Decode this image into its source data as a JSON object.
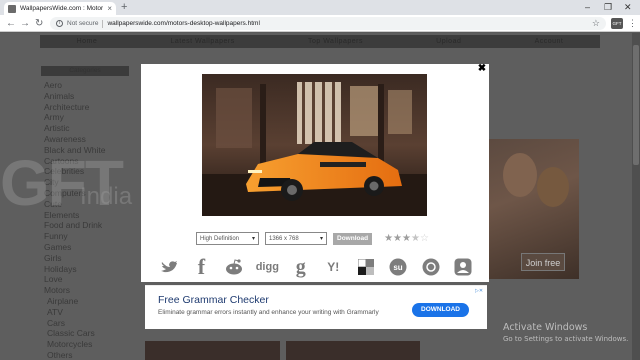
{
  "browser": {
    "tab_title": "WallpapersWide.com : Motors W",
    "tab_close": "×",
    "new_tab": "+",
    "window_controls": [
      "–",
      "❐",
      "✕"
    ],
    "nav": {
      "back": "←",
      "forward": "→",
      "reload": "↻"
    },
    "security_label": "Not secure",
    "url": "wallpaperswide.com/motors-desktop-wallpapers.html",
    "profile_label": "GFT",
    "menu_icon": "⋮"
  },
  "page": {
    "topnav": [
      "Home",
      "Latest Wallpapers",
      "Top Wallpapers",
      "Upload",
      "Account"
    ],
    "sidebar_heading": "Categories",
    "categories": [
      "Aero",
      "Animals",
      "Architecture",
      "Army",
      "Artistic",
      "Awareness",
      "Black and White",
      "Cartoons",
      "Celebrities",
      "City",
      "Computers",
      "Cute",
      "Elements",
      "Food and Drink",
      "Funny",
      "Games",
      "Girls",
      "Holidays",
      "Love",
      "Motors"
    ],
    "subcategories": [
      "Airplane",
      "ATV",
      "Cars",
      "Classic Cars",
      "Motorcycles",
      "Others"
    ],
    "watermark": "GFT",
    "watermark_sub": "India",
    "side_ad_button": "Join free",
    "activate_title": "Activate Windows",
    "activate_text": "Go to Settings to activate Windows."
  },
  "modal": {
    "close": "✖",
    "quality_select": "High Definition",
    "resolution_select": "1366 x 768",
    "download_label": "Download",
    "rating": 3.5,
    "stars_filled": "★★★",
    "stars_half": "★",
    "stars_empty": "☆",
    "socials": [
      {
        "name": "twitter-icon",
        "glyph": "t"
      },
      {
        "name": "facebook-icon",
        "glyph": "f"
      },
      {
        "name": "reddit-icon",
        "glyph": "👽"
      },
      {
        "name": "digg-icon",
        "glyph": "digg"
      },
      {
        "name": "google-icon",
        "glyph": "g"
      },
      {
        "name": "yahoo-icon",
        "glyph": "Y!"
      },
      {
        "name": "delicious-icon",
        "glyph": "▦"
      },
      {
        "name": "stumbleupon-icon",
        "glyph": "su"
      },
      {
        "name": "refresh-icon",
        "glyph": "⟳"
      },
      {
        "name": "myspace-icon",
        "glyph": "👥"
      }
    ],
    "ad": {
      "title": "Free Grammar Checker",
      "text": "Eliminate grammar errors instantly and enhance your writing with Grammarly",
      "button": "DOWNLOAD",
      "mark": "▷✕"
    }
  },
  "colors": {
    "accent_orange": "#f08a1c",
    "ad_blue": "#1a73e8",
    "overlay": "#5e5e5e"
  }
}
